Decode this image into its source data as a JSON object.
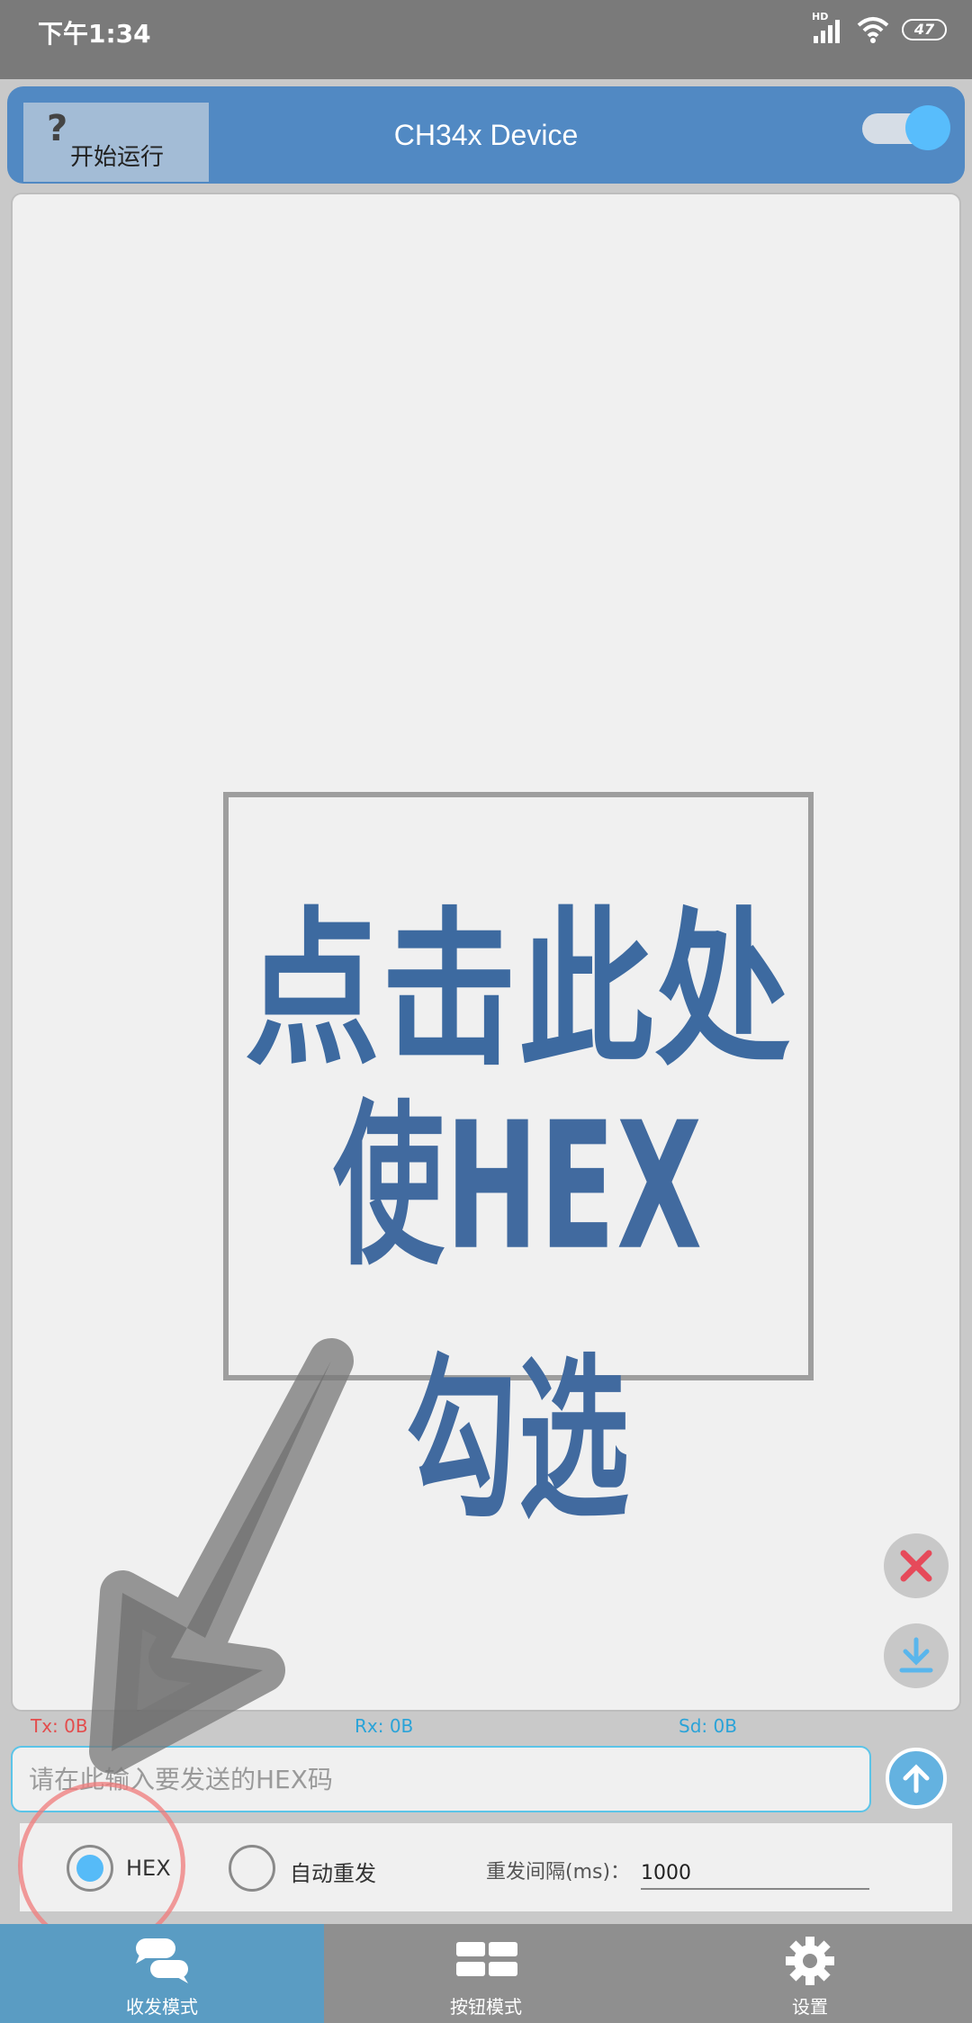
{
  "status_bar": {
    "time": "下午1:34",
    "network": "HD",
    "battery": "47"
  },
  "header": {
    "start_label": "开始运行",
    "help_icon": "question-icon",
    "title": "CH34x Device",
    "toggle_on": true
  },
  "overlay": {
    "line1": "点击此处",
    "line2": "使HEX勾选"
  },
  "counters": {
    "tx": "Tx: 0B",
    "rx": "Rx: 0B",
    "sd": "Sd: 0B"
  },
  "send": {
    "placeholder": "请在此输入要发送的HEX码",
    "value": ""
  },
  "options": {
    "hex_label": "HEX",
    "hex_checked": true,
    "auto_label": "自动重发",
    "auto_checked": false,
    "interval_label": "重发间隔(ms)：",
    "interval_value": "1000"
  },
  "nav": [
    {
      "label": "收发模式",
      "icon": "chat-icon",
      "active": true
    },
    {
      "label": "按钮模式",
      "icon": "grid-buttons-icon",
      "active": false
    },
    {
      "label": "设置",
      "icon": "gear-icon",
      "active": false
    }
  ],
  "colors": {
    "header": "#5189c3",
    "accent": "#56bbf8",
    "tx": "#e34d4d",
    "rx": "#2aa3d8",
    "nav_active": "#5a9cc3"
  }
}
